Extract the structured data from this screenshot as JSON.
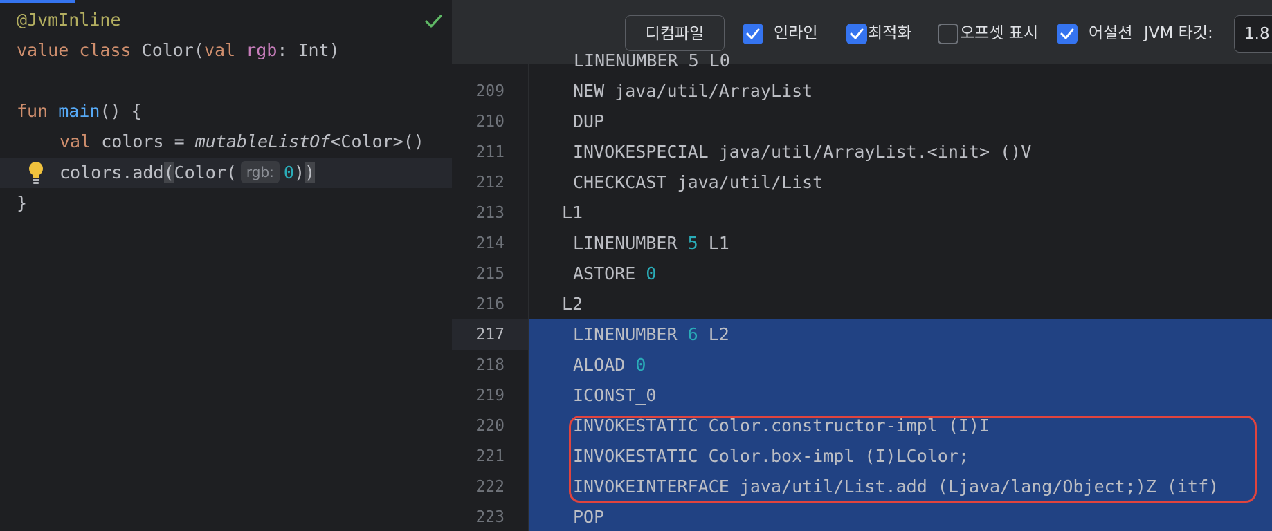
{
  "editor": {
    "lines": [
      {
        "annotation": "@JvmInline"
      },
      {
        "kw1": "value",
        "kw2": "class",
        "name": "Color(",
        "kw3": "val",
        "prop": "rgb",
        "rest": ": Int)"
      },
      {},
      {
        "kw": "fun",
        "fn": "main",
        "rest": "() {"
      },
      {
        "kw": "val",
        "name": "colors = ",
        "call": "mutableListOf",
        "rest": "<Color>()"
      },
      {
        "pre": "colors.add",
        "p1": "(",
        "mid": "Color(",
        "hint": "rgb:",
        "num": "0",
        "p2": ")",
        "p3": ")"
      },
      {
        "text": "}"
      }
    ]
  },
  "toolbar": {
    "decompile_label": "디컴파일",
    "inline_label": "인라인",
    "inline_checked": true,
    "optimize_label": "최적화",
    "optimize_checked": true,
    "offsets_label": "오프셋 표시",
    "offsets_checked": false,
    "assertions_label": "어설션",
    "assertions_checked": true,
    "jvm_target_label": "JVM 타깃:",
    "jvm_target_value": "1.8"
  },
  "bytecode": {
    "partial_top": "LINENUMBER 5 L0",
    "lines": [
      {
        "no": "209",
        "indent": 2,
        "text": "NEW java/util/ArrayList"
      },
      {
        "no": "210",
        "indent": 2,
        "text": "DUP"
      },
      {
        "no": "211",
        "indent": 2,
        "text": "INVOKESPECIAL java/util/ArrayList.<init> ()V"
      },
      {
        "no": "212",
        "indent": 2,
        "text": "CHECKCAST java/util/List"
      },
      {
        "no": "213",
        "indent": 1,
        "text": "L1"
      },
      {
        "no": "214",
        "indent": 2,
        "text": "LINENUMBER ",
        "num": "5",
        "after": " L1"
      },
      {
        "no": "215",
        "indent": 2,
        "text": "ASTORE ",
        "num": "0",
        "after": ""
      },
      {
        "no": "216",
        "indent": 1,
        "text": "L2"
      },
      {
        "no": "217",
        "indent": 2,
        "text": "LINENUMBER ",
        "num": "6",
        "after": " L2"
      },
      {
        "no": "218",
        "indent": 2,
        "text": "ALOAD ",
        "num": "0",
        "after": ""
      },
      {
        "no": "219",
        "indent": 2,
        "text": "ICONST_0"
      },
      {
        "no": "220",
        "indent": 2,
        "text": "INVOKESTATIC Color.constructor-impl (I)I"
      },
      {
        "no": "221",
        "indent": 2,
        "text": "INVOKESTATIC Color.box-impl (I)LColor;"
      },
      {
        "no": "222",
        "indent": 2,
        "text": "INVOKEINTERFACE java/util/List.add (Ljava/lang/Object;)Z (itf)"
      },
      {
        "no": "223",
        "indent": 2,
        "text": "POP"
      }
    ]
  },
  "colors": {
    "selection": "#214283",
    "highlight_box": "#e0443e",
    "checkbox_on": "#3574f0"
  }
}
